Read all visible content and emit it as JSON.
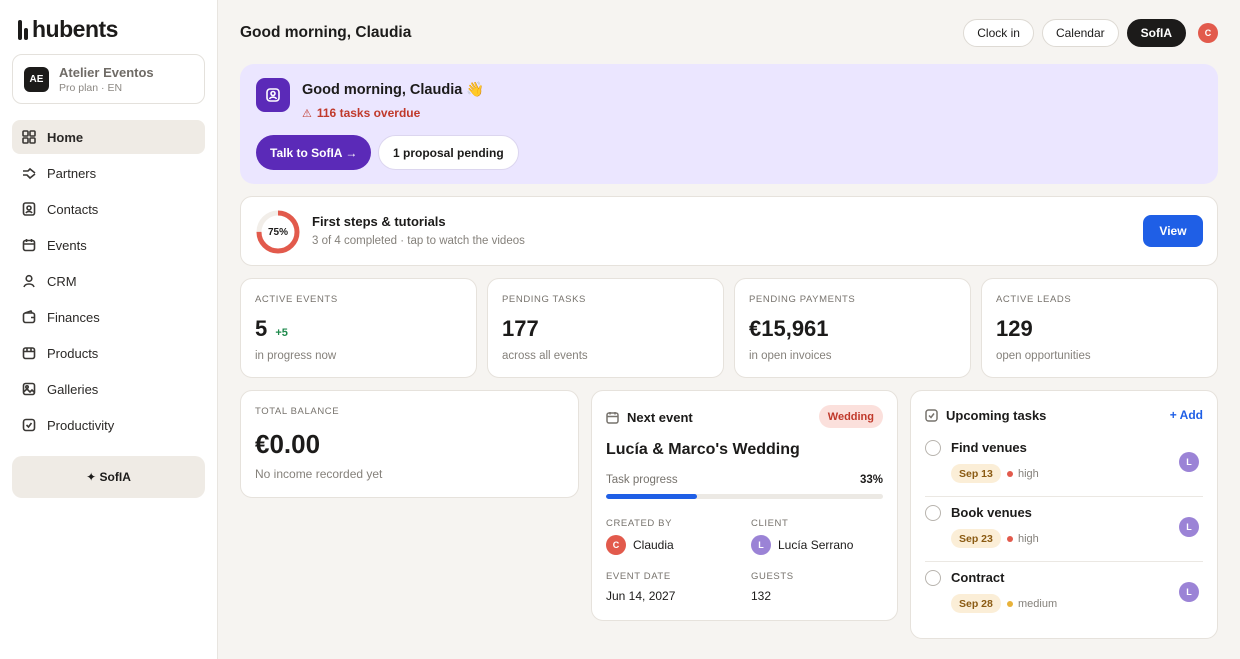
{
  "app": {
    "logo_text": "hubents"
  },
  "workspace": {
    "avatar": "AE",
    "name": "Atelier Eventos",
    "sub": "Pro plan · EN"
  },
  "sidebar": {
    "items": [
      {
        "label": "Home",
        "icon": "home-grid-icon",
        "active": true
      },
      {
        "label": "Partners",
        "icon": "handshake-icon",
        "active": false
      },
      {
        "label": "Contacts",
        "icon": "contact-card-icon",
        "active": false
      },
      {
        "label": "Events",
        "icon": "calendar-icon",
        "active": false
      },
      {
        "label": "CRM",
        "icon": "person-icon",
        "active": false
      },
      {
        "label": "Finances",
        "icon": "wallet-icon",
        "active": false
      },
      {
        "label": "Products",
        "icon": "box-icon",
        "active": false
      },
      {
        "label": "Galleries",
        "icon": "image-icon",
        "active": false
      },
      {
        "label": "Productivity",
        "icon": "check-square-icon",
        "active": false
      }
    ],
    "sofia_label": "✦ SofIA"
  },
  "header": {
    "title": "Good morning, Claudia",
    "clock_in": "Clock in",
    "calendar": "Calendar",
    "sofia": "SofIA",
    "user_initial": "C"
  },
  "hero": {
    "greeting": "Good morning, Claudia 👋",
    "overdue": "116 tasks overdue",
    "talk_button": "Talk to SofIA →",
    "proposal_button": "1 proposal pending"
  },
  "tutorials": {
    "percent_label": "75%",
    "progress": 0.75,
    "title": "First steps & tutorials",
    "sub": "3 of 4 completed · tap to watch the videos",
    "view_button": "View"
  },
  "stats": [
    {
      "label": "ACTIVE EVENTS",
      "value": "5",
      "delta": "+5",
      "sub": "in progress now"
    },
    {
      "label": "PENDING TASKS",
      "value": "177",
      "delta": "",
      "sub": "across all events"
    },
    {
      "label": "PENDING PAYMENTS",
      "value": "€15,961",
      "delta": "",
      "sub": "in open invoices"
    },
    {
      "label": "ACTIVE LEADS",
      "value": "129",
      "delta": "",
      "sub": "open opportunities"
    }
  ],
  "balance": {
    "label": "TOTAL BALANCE",
    "value": "€0.00",
    "sub": "No income recorded yet"
  },
  "next_event": {
    "heading": "Next event",
    "badge": "Wedding",
    "title": "Lucía & Marco's Wedding",
    "progress_label": "Task progress",
    "progress_text": "33%",
    "progress": 0.33,
    "created_by_label": "CREATED BY",
    "created_by": "Claudia",
    "created_by_initial": "C",
    "client_label": "CLIENT",
    "client": "Lucía Serrano",
    "client_initial": "L",
    "date_label": "EVENT DATE",
    "date": "Jun 14, 2027",
    "guests_label": "GUESTS",
    "guests": "132"
  },
  "upcoming": {
    "heading": "Upcoming tasks",
    "add": "+ Add",
    "tasks": [
      {
        "name": "Find venues",
        "date": "Sep 13",
        "priority": "high",
        "priority_color": "#e25a4c",
        "assignee": "L"
      },
      {
        "name": "Book venues",
        "date": "Sep 23",
        "priority": "high",
        "priority_color": "#e25a4c",
        "assignee": "L"
      },
      {
        "name": "Contract",
        "date": "Sep 28",
        "priority": "medium",
        "priority_color": "#e8b23a",
        "assignee": "L"
      }
    ]
  },
  "colors": {
    "accent": "#5b2ab8",
    "primary": "#1f5fe6",
    "danger": "#c0392b"
  }
}
